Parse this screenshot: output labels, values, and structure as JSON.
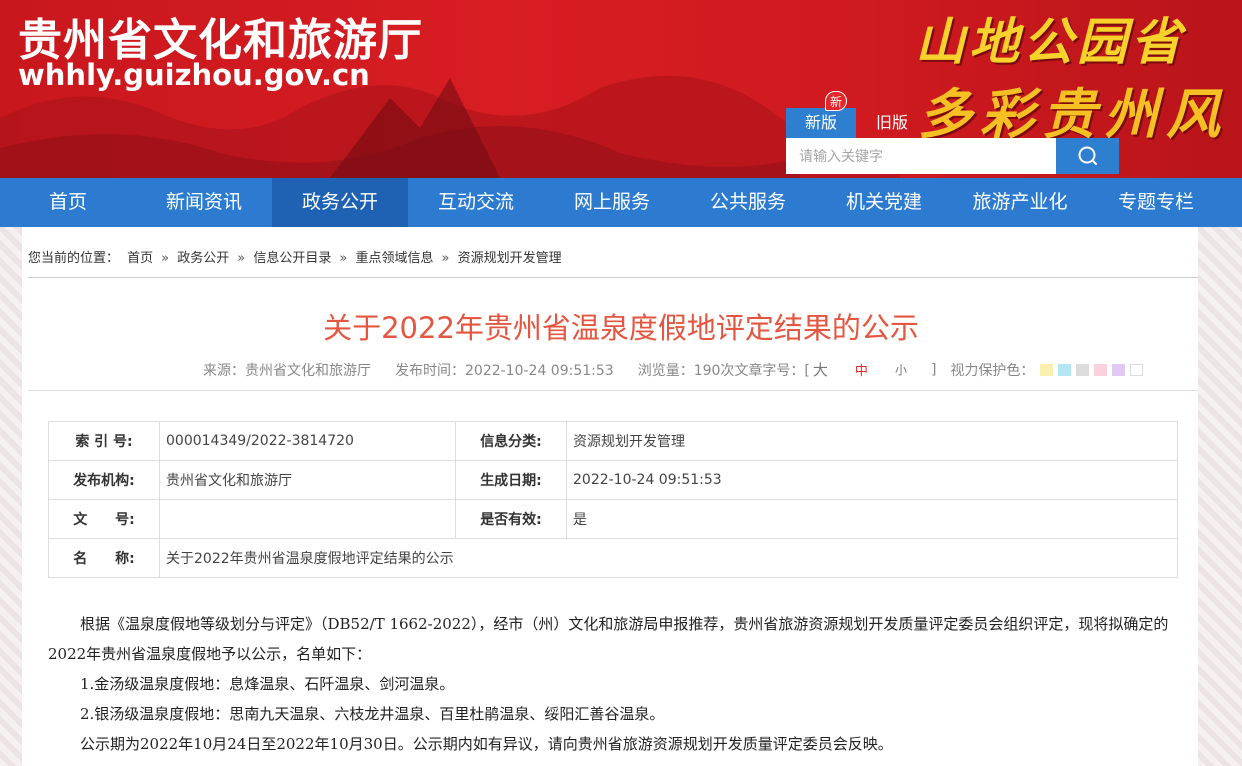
{
  "header": {
    "site_title": "贵州省文化和旅游厅",
    "site_url": "whhly.guizhou.gov.cn",
    "slogan_line1": "山地公园省",
    "slogan_line2": "多彩贵州风",
    "version_new": "新版",
    "version_new_badge": "新",
    "version_old": "旧版",
    "search_placeholder": "请输入关键字",
    "search_icon": "search-icon"
  },
  "nav": {
    "items": [
      "首页",
      "新闻资讯",
      "政务公开",
      "互动交流",
      "网上服务",
      "公共服务",
      "机关党建",
      "旅游产业化",
      "专题专栏"
    ],
    "active_index": 2
  },
  "breadcrumb": {
    "label": "您当前的位置：",
    "items": [
      "首页",
      "政务公开",
      "信息公开目录",
      "重点领域信息",
      "资源规划开发管理"
    ],
    "separator": "»"
  },
  "article": {
    "title": "关于2022年贵州省温泉度假地评定结果的公示",
    "source": "来源：贵州省文化和旅游厅",
    "publish_time": "发布时间：2022-10-24 09:51:53",
    "views": "浏览量：190次",
    "font_size_label": "文章字号：[",
    "font_big": "大",
    "font_mid": "中",
    "font_small": "小",
    "font_size_close": "]",
    "eye_protect_label": "视力保护色：",
    "eye_colors": [
      "#f9efb0",
      "#b4e6f3",
      "#dcdcdc",
      "#fad1dc",
      "#e0c9f2",
      "#ffffff"
    ]
  },
  "info_table": {
    "index_label": "索 引 号:",
    "index_value": "000014349/2022-3814720",
    "category_label": "信息分类:",
    "category_value": "资源规划开发管理",
    "publisher_label": "发布机构:",
    "publisher_value": "贵州省文化和旅游厅",
    "date_label": "生成日期:",
    "date_value": "2022-10-24 09:51:53",
    "doc_label": "文　　号:",
    "doc_value": "",
    "valid_label": "是否有效:",
    "valid_value": "是",
    "name_label": "名　　称:",
    "name_value": "关于2022年贵州省温泉度假地评定结果的公示"
  },
  "body": {
    "p1": "根据《温泉度假地等级划分与评定》（DB52/T 1662-2022），经市（州）文化和旅游局申报推荐，贵州省旅游资源规划开发质量评定委员会组织评定，现将拟确定的2022年贵州省温泉度假地予以公示，名单如下：",
    "p2": "1.金汤级温泉度假地：息烽温泉、石阡温泉、剑河温泉。",
    "p3": "2.银汤级温泉度假地：思南九天温泉、六枝龙井温泉、百里杜鹃温泉、绥阳汇善谷温泉。",
    "p4": "公示期为2022年10月24日至2022年10月30日。公示期内如有异议，请向贵州省旅游资源规划开发质量评定委员会反映。"
  }
}
